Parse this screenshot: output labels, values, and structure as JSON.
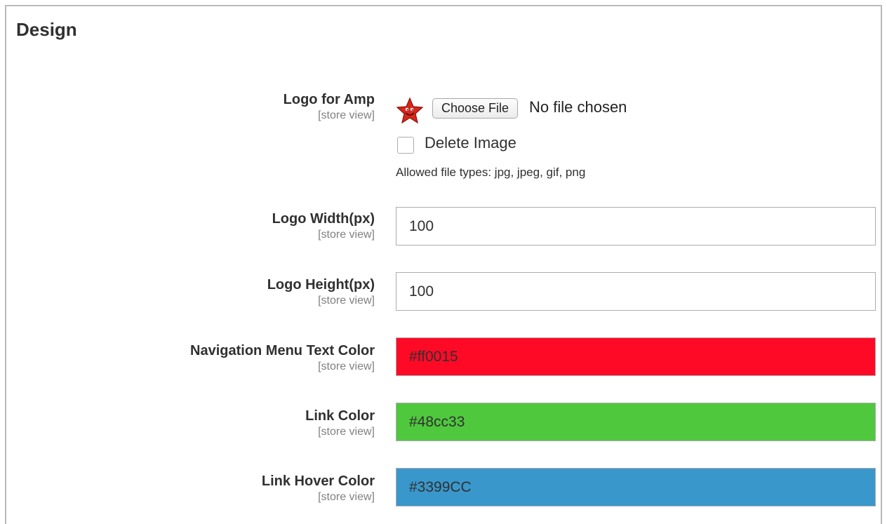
{
  "section": {
    "title": "Design"
  },
  "fields": {
    "logo": {
      "label": "Logo for Amp",
      "scope": "[store view]",
      "choose_button": "Choose File",
      "no_file_text": "No file chosen",
      "delete_label": "Delete Image",
      "delete_checked": false,
      "allowed_types": "Allowed file types: jpg, jpeg, gif, png",
      "thumbnail_icon": "red-star-logo-icon"
    },
    "logo_width": {
      "label": "Logo Width(px)",
      "scope": "[store view]",
      "value": "100"
    },
    "logo_height": {
      "label": "Logo Height(px)",
      "scope": "[store view]",
      "value": "100"
    },
    "nav_text_color": {
      "label": "Navigation Menu Text Color",
      "scope": "[store view]",
      "value": "#ff0015",
      "bg": "#ff0a26"
    },
    "link_color": {
      "label": "Link Color",
      "scope": "[store view]",
      "value": "#48cc33",
      "bg": "#4fc83e"
    },
    "link_hover_color": {
      "label": "Link Hover Color",
      "scope": "[store view]",
      "value": "#3399CC",
      "bg": "#3a97cb"
    }
  }
}
